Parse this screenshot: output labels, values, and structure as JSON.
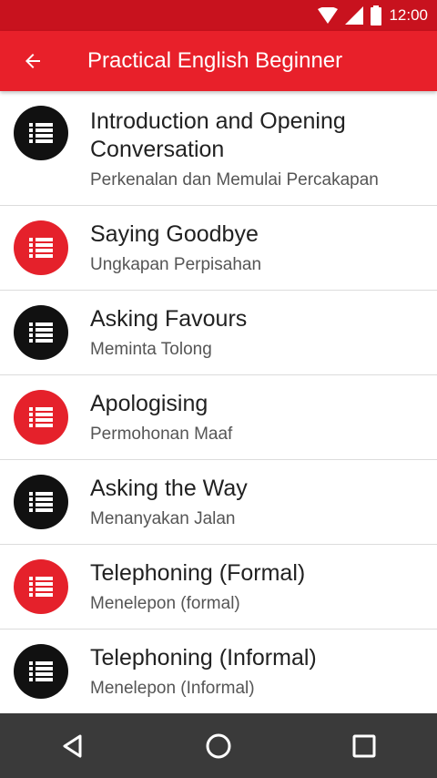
{
  "status_bar": {
    "time": "12:00",
    "icons": [
      "wifi-icon",
      "signal-icon",
      "battery-icon"
    ]
  },
  "app_bar": {
    "title": "Practical English Beginner",
    "back_icon": "arrow-back-icon",
    "color": "#e8202a"
  },
  "colors": {
    "status_bar": "#c8121e",
    "accent_red": "#e5212b",
    "avatar_black": "#111111",
    "nav_bar": "#3a3a3a"
  },
  "lessons": [
    {
      "title": "Introduction and Opening Conversation",
      "subtitle": "Perkenalan dan Memulai Percakapan",
      "icon": "list-icon",
      "icon_color": "black"
    },
    {
      "title": "Saying Goodbye",
      "subtitle": "Ungkapan Perpisahan",
      "icon": "list-icon",
      "icon_color": "red"
    },
    {
      "title": "Asking Favours",
      "subtitle": "Meminta Tolong",
      "icon": "list-icon",
      "icon_color": "black"
    },
    {
      "title": "Apologising",
      "subtitle": "Permohonan Maaf",
      "icon": "list-icon",
      "icon_color": "red"
    },
    {
      "title": "Asking the Way",
      "subtitle": "Menanyakan Jalan",
      "icon": "list-icon",
      "icon_color": "black"
    },
    {
      "title": "Telephoning (Formal)",
      "subtitle": "Menelepon (formal)",
      "icon": "list-icon",
      "icon_color": "red"
    },
    {
      "title": "Telephoning (Informal)",
      "subtitle": "Menelepon (Informal)",
      "icon": "list-icon",
      "icon_color": "black"
    }
  ],
  "nav_bar": {
    "buttons": [
      "back-triangle-icon",
      "home-circle-icon",
      "recents-square-icon"
    ]
  }
}
